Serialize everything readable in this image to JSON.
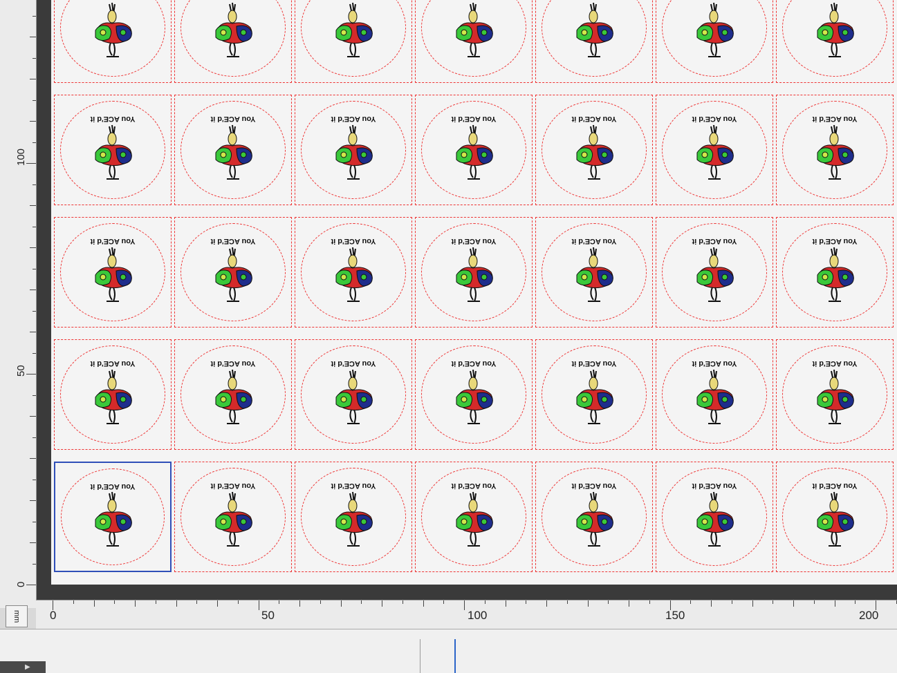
{
  "rulers": {
    "units": "mm",
    "horizontal_labels": [
      "0",
      "50",
      "100",
      "150",
      "200"
    ],
    "vertical_labels": [
      "100",
      "50",
      "0"
    ]
  },
  "label_sheet": {
    "caption": "You ACE'd it",
    "rows": 5,
    "columns": 7,
    "selected_cell": [
      4,
      0
    ]
  },
  "icons": {
    "mascot": "cartoon-mascot-icon",
    "expander": "triangle-expander-icon"
  },
  "colors": {
    "cut_line": "#e33333",
    "selection": "#2f4fb8",
    "workspace": "#3a3a3a"
  }
}
